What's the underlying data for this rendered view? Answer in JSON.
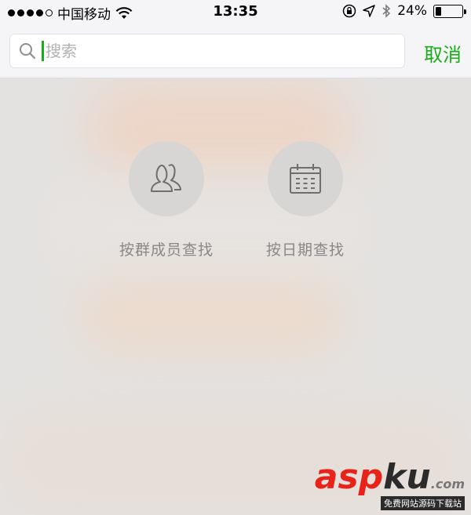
{
  "status_bar": {
    "carrier": "中国移动",
    "time": "13:35",
    "battery_percent": "24%",
    "battery_level": 0.24,
    "signal_bars_filled": 4,
    "signal_bars_total": 5
  },
  "search": {
    "placeholder": "搜索",
    "value": "",
    "cancel_label": "取消"
  },
  "options": [
    {
      "label": "按群成员查找",
      "icon": "group-members-icon"
    },
    {
      "label": "按日期查找",
      "icon": "calendar-icon"
    }
  ],
  "watermark": {
    "logo_a": "asp",
    "logo_b": "ku",
    "logo_c": ".com",
    "subtitle": "免费网站源码下载站"
  },
  "colors": {
    "accent": "#1aad19"
  }
}
